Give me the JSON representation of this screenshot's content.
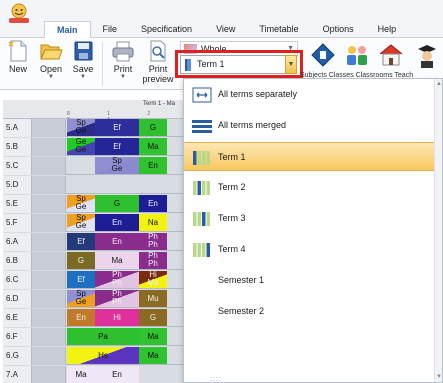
{
  "ribbon_tabs": [
    "Main",
    "File",
    "Specification",
    "View",
    "Timetable",
    "Options",
    "Help"
  ],
  "active_tab": "Main",
  "ribbon_buttons": {
    "new": "New",
    "open": "Open",
    "save": "Save",
    "print": "Print",
    "print_preview_line1": "Print",
    "print_preview_line2": "preview"
  },
  "whole_combo": {
    "value": "Whole"
  },
  "term_combo": {
    "value": "Term 1"
  },
  "partial_labels": "Subjects  Classes  Classrooms  Teach",
  "grid_header": "Term 1 - Ma",
  "grid_ticks": "8 1 2 3 4",
  "rows": [
    {
      "label": "5.A",
      "cells": [
        {
          "l": 64,
          "w": 28,
          "t": "Sp",
          "b": "Ge",
          "bg": "#8f8fd2",
          "bg2": "#2b2b8a"
        },
        {
          "l": 92,
          "w": 44,
          "t": "Ef",
          "bg": "#2d2d9c"
        },
        {
          "l": 136,
          "w": 28,
          "t": "G",
          "bg": "#2ec02e"
        }
      ]
    },
    {
      "label": "5.B",
      "cells": [
        {
          "l": 64,
          "w": 28,
          "t": "Ge",
          "b": "Ge",
          "bg": "#22c922",
          "bg2": "#4444b0"
        },
        {
          "l": 92,
          "w": 44,
          "t": "Ef",
          "bg": "#25259a"
        },
        {
          "l": 136,
          "w": 28,
          "t": "Ma",
          "bg": "#2fc42f"
        }
      ]
    },
    {
      "label": "5.C",
      "cells": [
        {
          "l": 92,
          "w": 44,
          "t": "Sp",
          "b": "Ge",
          "bg": "#8f8fd2",
          "bg2": "#8a8ad0"
        },
        {
          "l": 136,
          "w": 28,
          "t": "En",
          "bg": "#2fc42f"
        }
      ]
    },
    {
      "label": "5.D",
      "cells": []
    },
    {
      "label": "5.E",
      "cells": [
        {
          "l": 64,
          "w": 28,
          "t": "Sp",
          "b": "Ge",
          "bg": "#f0a020",
          "bg2": "#e2e2f6"
        },
        {
          "l": 92,
          "w": 44,
          "t": "G",
          "bg": "#2ec02e"
        },
        {
          "l": 136,
          "w": 28,
          "t": "En",
          "bg": "#1d1d96"
        }
      ]
    },
    {
      "label": "5.F",
      "cells": [
        {
          "l": 64,
          "w": 28,
          "t": "Sp",
          "b": "Ge",
          "bg": "#f0a020",
          "bg2": "#e2e2f6"
        },
        {
          "l": 92,
          "w": 44,
          "t": "En",
          "bg": "#1d1d96"
        },
        {
          "l": 136,
          "w": 28,
          "t": "Na",
          "bg": "#f3f312"
        }
      ]
    },
    {
      "label": "6.A",
      "cells": [
        {
          "l": 64,
          "w": 28,
          "t": "Ef",
          "bg": "#233a7a"
        },
        {
          "l": 92,
          "w": 44,
          "t": "En",
          "bg": "#8a2c8c"
        },
        {
          "l": 136,
          "w": 28,
          "t": "Ph",
          "b": "Ph",
          "bg": "#8a2c8c",
          "bg2": "#8a2c8c"
        }
      ]
    },
    {
      "label": "6.B",
      "cells": [
        {
          "l": 64,
          "w": 28,
          "t": "G",
          "bg": "#7b6a24"
        },
        {
          "l": 92,
          "w": 44,
          "t": "Ma",
          "bg": "#ecd4ec"
        },
        {
          "l": 136,
          "w": 28,
          "t": "Ph",
          "b": "Ph",
          "bg": "#8a2c8c",
          "bg2": "#8a2c8c"
        }
      ]
    },
    {
      "label": "6.C",
      "cells": [
        {
          "l": 64,
          "w": 28,
          "t": "Ef",
          "bg": "#1d6fbf"
        },
        {
          "l": 92,
          "w": 44,
          "t": "Ph",
          "b": "Ph",
          "bg": "#8a2c8c",
          "bg2": "#e2c4e2"
        },
        {
          "l": 136,
          "w": 28,
          "t": "Hi",
          "b": "Ma",
          "bg": "#7a2a10",
          "bg2": "#f3f312"
        }
      ]
    },
    {
      "label": "6.D",
      "cells": [
        {
          "l": 64,
          "w": 28,
          "t": "Sp",
          "b": "Ge",
          "bg": "#8f8fd2",
          "bg2": "#f0a020"
        },
        {
          "l": 92,
          "w": 44,
          "t": "Ph",
          "b": "Ph",
          "bg": "#8a2c8c",
          "bg2": "#e2c4e2"
        },
        {
          "l": 136,
          "w": 28,
          "t": "Mu",
          "bg": "#8b6a24"
        }
      ]
    },
    {
      "label": "6.E",
      "cells": [
        {
          "l": 64,
          "w": 28,
          "t": "En",
          "bg": "#c07a2a"
        },
        {
          "l": 92,
          "w": 44,
          "t": "Hi",
          "bg": "#e0309c"
        },
        {
          "l": 136,
          "w": 28,
          "t": "G",
          "bg": "#8b6a24"
        }
      ]
    },
    {
      "label": "6.F",
      "cells": [
        {
          "l": 64,
          "w": 72,
          "t": "Pa",
          "bg": "#2ec02e"
        },
        {
          "l": 136,
          "w": 28,
          "t": "Ma",
          "bg": "#2fc42f"
        }
      ]
    },
    {
      "label": "6.G",
      "cells": [
        {
          "l": 64,
          "w": 72,
          "t": "Hs",
          "bg": "#f3f312",
          "bg2": "#5b34c0"
        },
        {
          "l": 136,
          "w": 28,
          "t": "Ma",
          "bg": "#2fc42f"
        }
      ]
    },
    {
      "label": "7.A",
      "cells": [
        {
          "l": 64,
          "w": 28,
          "t": "Ma",
          "bg": "#f0e8f8"
        },
        {
          "l": 92,
          "w": 44,
          "t": "En",
          "bg": "#f0e8f8"
        }
      ]
    }
  ],
  "popup_items": [
    {
      "label": "All terms separately",
      "icon": "all-terms-separately-icon"
    },
    {
      "label": "All terms merged",
      "icon": "all-terms-merged-icon"
    },
    {
      "label": "Term 1",
      "icon": "term-1-icon",
      "selected": true
    },
    {
      "label": "Term 2",
      "icon": "term-2-icon"
    },
    {
      "label": "Term 3",
      "icon": "term-3-icon"
    },
    {
      "label": "Term 4",
      "icon": "term-4-icon"
    },
    {
      "label": "Semester 1",
      "icon": ""
    },
    {
      "label": "Semester 2",
      "icon": ""
    }
  ],
  "colors": {
    "accent": "#2a5d9f",
    "highlight_border": "#e02020",
    "selected_item": "#f8c85e"
  }
}
